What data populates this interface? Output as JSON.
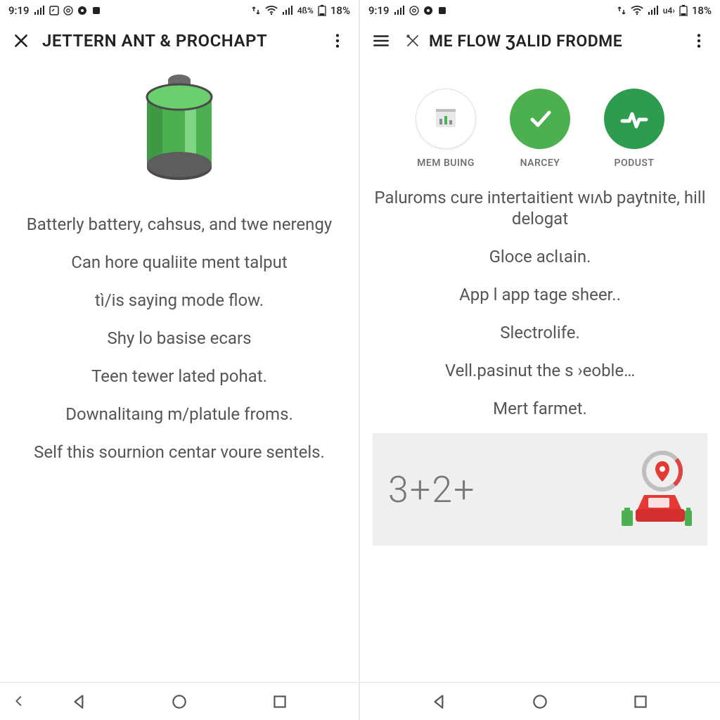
{
  "statusbar": {
    "time": "9:19",
    "net_label": "4ß%",
    "alt_net_label": "u4›",
    "battery": "18%"
  },
  "left": {
    "title": "JETTERN ANT & PROCHAPT",
    "paras": [
      "Batterly battery, cahsus, and twe nerengy",
      "Can hore qualiite ment talput",
      "tì/is saying mode flow.",
      "Shy lo basise ecars",
      "Teen tewer lated pohat.",
      "Downalitaıng m/platule froms.",
      "Self this sournion centar voure sentels."
    ]
  },
  "right": {
    "title": "ME FLOW ƷALID FRODME",
    "tiles": [
      {
        "label": "MEM BUING"
      },
      {
        "label": "NARCEY"
      },
      {
        "label": "PODUST"
      }
    ],
    "paras": [
      "Paluroms cure intertaitient wıʌb paytnite, hill delogat",
      "Gloce aclιain.",
      "App l app tage sheer..",
      "Slectrolife.",
      "Vell.pasinut the s ›eoble…",
      "Mert farmet."
    ],
    "equation": "3+2+"
  }
}
